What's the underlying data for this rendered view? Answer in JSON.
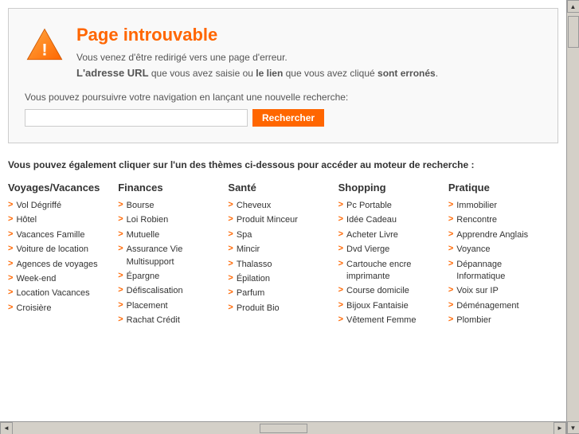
{
  "page": {
    "title": "Page introuvable",
    "subtitle_orange": "Page introuvable",
    "error_line1": "Vous venez d'être redirigé vers une page d'erreur.",
    "error_line2_part1": "L'adresse URL",
    "error_line2_part2": " que vous avez saisie ou ",
    "error_line2_part3": "le lien",
    "error_line2_part4": " que vous avez cliqué ",
    "error_line2_part5": "sont erronés",
    "error_line3": "Vous pouvez poursuivre votre navigation en lançant une nouvelle recherche:",
    "search_placeholder": "",
    "search_button": "Rechercher",
    "categories_intro": "Vous pouvez également cliquer sur l'un des thèmes ci-dessous pour accéder au moteur de recherche :"
  },
  "categories": [
    {
      "title": "Voyages/Vacances",
      "items": [
        "Vol Dégriffé",
        "Hôtel",
        "Vacances Famille",
        "Voiture de location",
        "Agences de voyages",
        "Week-end",
        "Location Vacances",
        "Croisière"
      ]
    },
    {
      "title": "Finances",
      "items": [
        "Bourse",
        "Loi Robien",
        "Mutuelle",
        "Assurance Vie Multisupport",
        "Épargne",
        "Défiscalisation",
        "Placement",
        "Rachat Crédit"
      ]
    },
    {
      "title": "Santé",
      "items": [
        "Cheveux",
        "Produit Minceur",
        "Spa",
        "Mincir",
        "Thalasso",
        "Épilation",
        "Parfum",
        "Produit Bio"
      ]
    },
    {
      "title": "Shopping",
      "items": [
        "Pc Portable",
        "Idée Cadeau",
        "Acheter Livre",
        "Dvd Vierge",
        "Cartouche encre imprimante",
        "Course domicile",
        "Bijoux Fantaisie",
        "Vêtement Femme"
      ]
    },
    {
      "title": "Pratique",
      "items": [
        "Immobilier",
        "Rencontre",
        "Apprendre Anglais",
        "Voyance",
        "Dépannage Informatique",
        "Voix sur IP",
        "Déménagement",
        "Plombier"
      ]
    }
  ]
}
